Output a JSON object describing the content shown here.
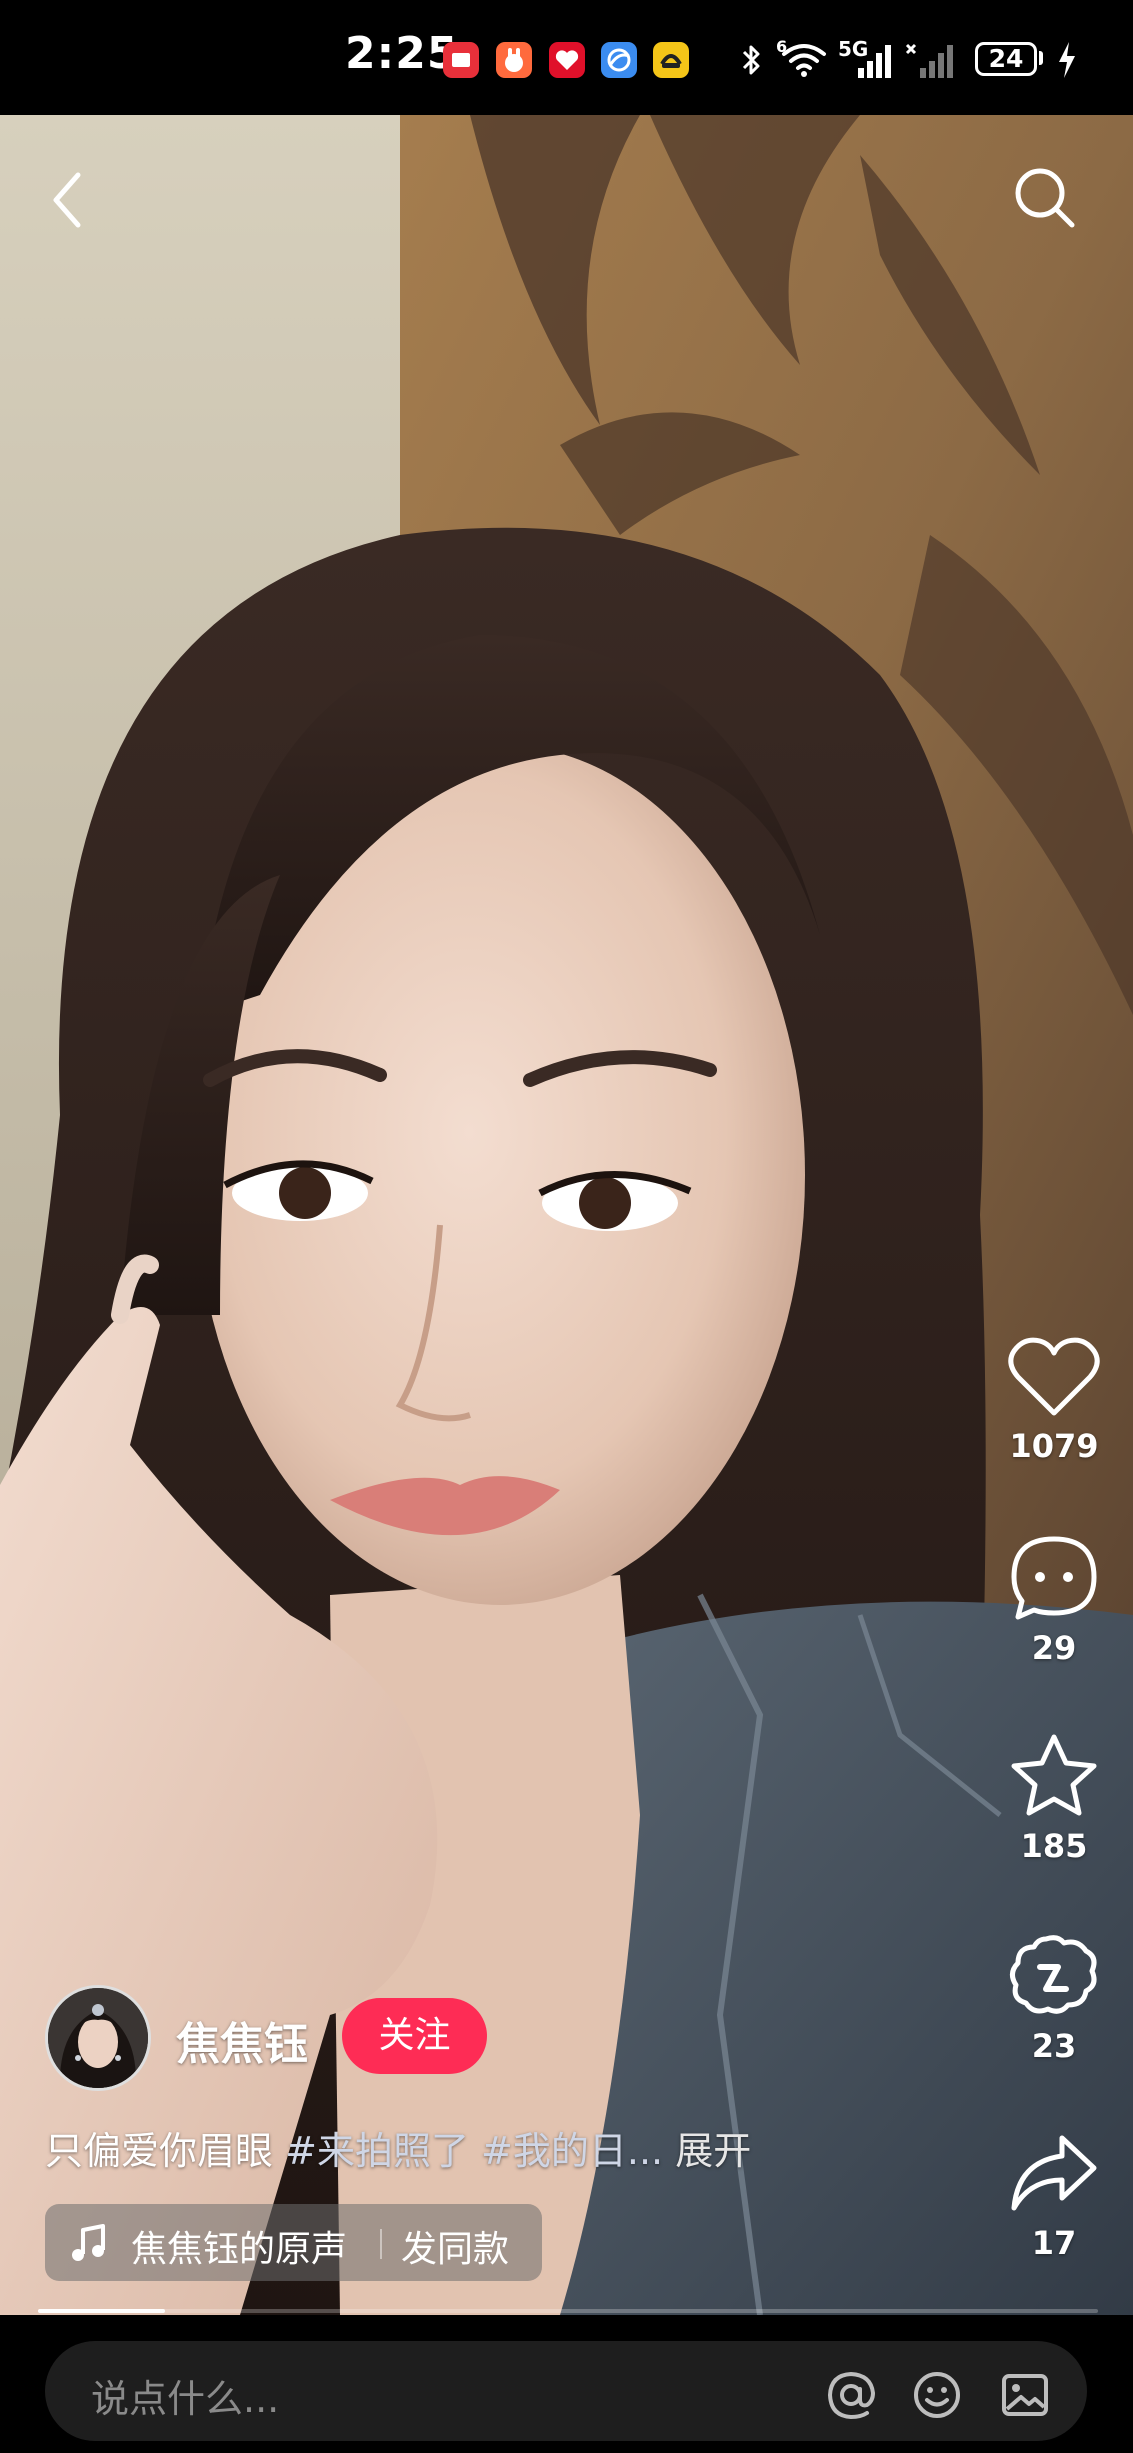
{
  "status_bar": {
    "time": "2:25",
    "network_label": "5G",
    "sim_indicator": "6",
    "battery_level": "24"
  },
  "video": {
    "back_icon": "chevron-left-icon",
    "search_icon": "search-icon",
    "progress_fraction": 0.12
  },
  "actions": {
    "like_count": "1079",
    "comment_count": "29",
    "favorite_count": "185",
    "recommend_count": "23",
    "share_count": "17"
  },
  "author": {
    "name": "焦焦钰",
    "follow_label": "关注"
  },
  "caption": {
    "text": "只偏爱你眉眼",
    "tag1": "#来拍照了",
    "tag2": "#我的日...",
    "expand_label": "展开"
  },
  "music": {
    "name": "焦焦钰的原声",
    "same_label": "发同款"
  },
  "comment_bar": {
    "placeholder": "说点什么..."
  },
  "colors": {
    "follow_button": "#fe2c55",
    "background": "#000000"
  }
}
